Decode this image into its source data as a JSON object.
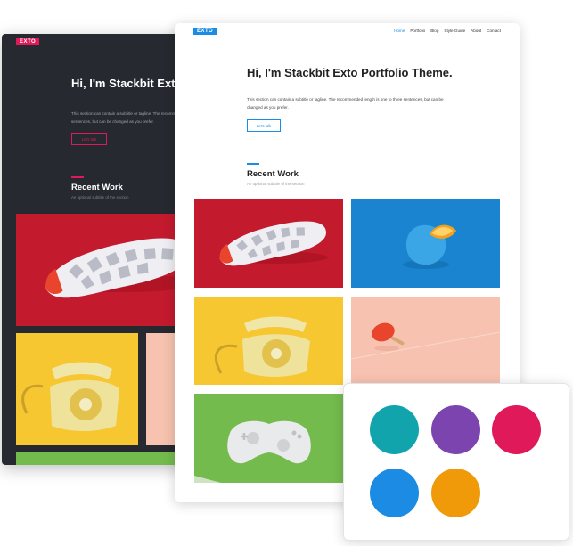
{
  "dark_site": {
    "logo": "EXTO",
    "title": "Hi, I'm Stackbit Exto Portfolio Theme.",
    "subtitle": "This section can contain a subtitle or tagline. The recommended length is one to three sentences, but can be changed as you prefer.",
    "cta_label": "Let's talk",
    "section_title": "Recent Work",
    "section_subtitle": "An optional subtitle of the section",
    "accent_color": "#e0195a",
    "background_color": "#262a30"
  },
  "light_site": {
    "logo": "EXTO",
    "nav": [
      "Home",
      "Portfolio",
      "Blog",
      "Style Guide",
      "About",
      "Contact"
    ],
    "title": "Hi, I'm Stackbit Exto Portfolio Theme.",
    "subtitle": "This section can contain a subtitle or tagline. The recommended length is one to three sentences, but can be changed as you prefer.",
    "cta_label": "Let's talk",
    "section_title": "Recent Work",
    "section_subtitle": "An optional subtitle of the section",
    "accent_color": "#1b8be3",
    "portfolio_images": [
      {
        "subject": "sneaker-sole-on-red",
        "background": "#c41a2e"
      },
      {
        "subject": "blue-orange-on-blue",
        "background": "#1b84d1"
      },
      {
        "subject": "yellow-rotary-phone-on-yellow",
        "background": "#f7c731"
      },
      {
        "subject": "ping-pong-paddle-on-pink",
        "background": "#f7c3b0"
      },
      {
        "subject": "white-game-controller-on-green",
        "background": "#74bb4d"
      }
    ]
  },
  "palette": {
    "colors": [
      "#12a4ac",
      "#7b44ae",
      "#e0195a",
      "#1b8be3",
      "#f09a0a"
    ]
  }
}
